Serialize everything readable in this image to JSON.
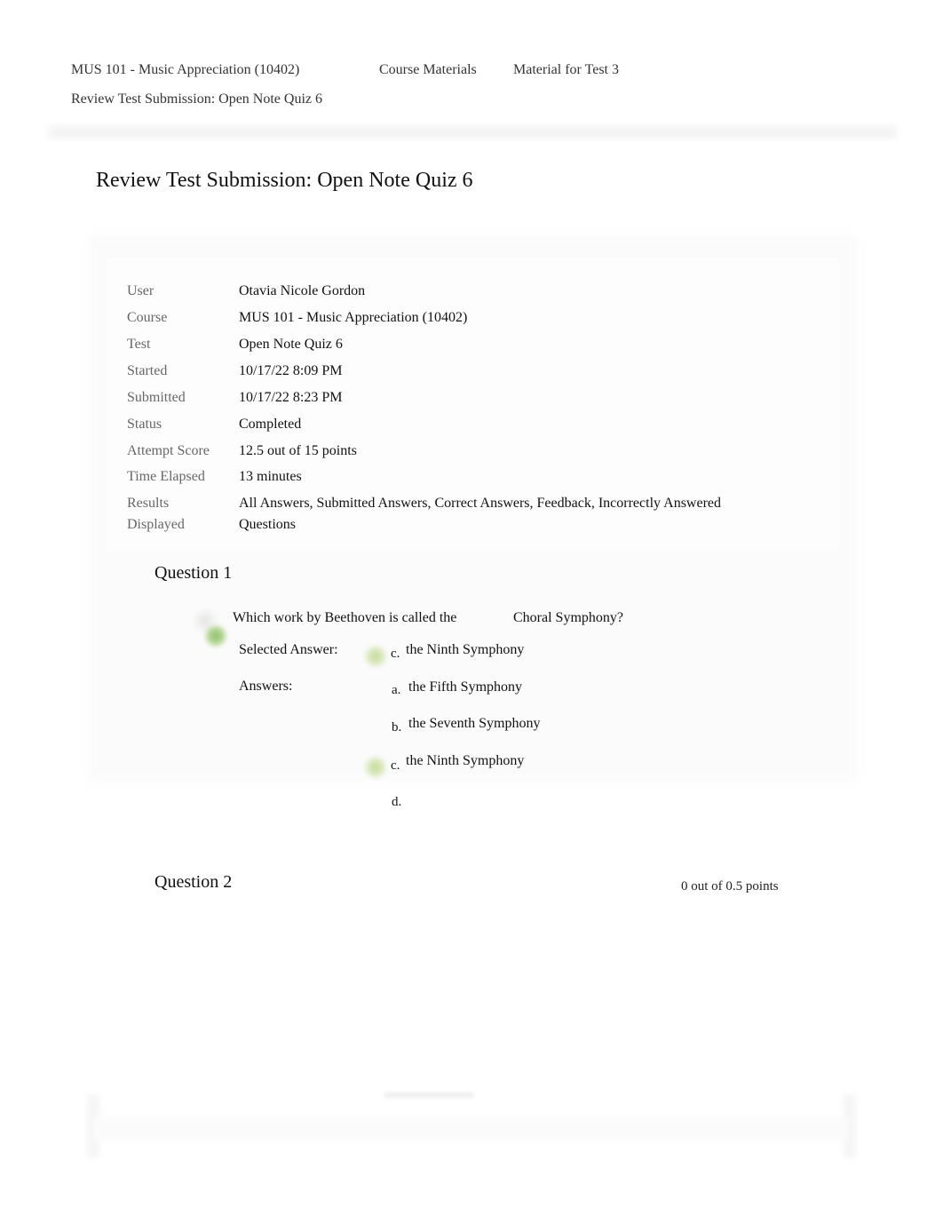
{
  "breadcrumbs": {
    "course": "MUS 101 - Music Appreciation (10402)",
    "course_materials": "Course Materials",
    "material_for_test": "Material for Test 3",
    "current": "Review Test Submission: Open Note Quiz 6"
  },
  "page_title": "Review Test Submission: Open Note Quiz 6",
  "info": [
    {
      "label": "User",
      "value": "Otavia Nicole Gordon"
    },
    {
      "label": "Course",
      "value": "MUS 101 - Music Appreciation (10402)"
    },
    {
      "label": "Test",
      "value": "Open Note Quiz 6"
    },
    {
      "label": "Started",
      "value": "10/17/22 8:09 PM"
    },
    {
      "label": "Submitted",
      "value": "10/17/22 8:23 PM"
    },
    {
      "label": "Status",
      "value": "Completed"
    },
    {
      "label": "Attempt Score",
      "value": "12.5 out of 15 points"
    },
    {
      "label": "Time Elapsed",
      "value": "13 minutes"
    },
    {
      "label_line1": "Results",
      "label_line2": "Displayed",
      "value_line1": "All Answers, Submitted Answers, Correct Answers, Feedback, Incorrectly Answered",
      "value_line2": "Questions"
    }
  ],
  "questions": [
    {
      "title": "Question 1",
      "text_part1": "Which work by Beethoven is called the",
      "text_part2": "Choral  Symphony?",
      "selected_label": "Selected Answer:",
      "selected_letter": "c.",
      "selected_answer": "the Ninth Symphony",
      "answers_label": "Answers:",
      "answers": [
        {
          "letter": "a.",
          "text": "the Fifth Symphony",
          "correct": false
        },
        {
          "letter": "b.",
          "text": "the Seventh Symphony",
          "correct": false
        },
        {
          "letter": "c.",
          "text": "the Ninth Symphony",
          "correct": true
        },
        {
          "letter": "d.",
          "text": "",
          "correct": false
        }
      ],
      "status_icon": "correct-check-icon"
    },
    {
      "title": "Question 2",
      "points": "0 out of 0.5 points"
    }
  ],
  "colors": {
    "correct_green": "#8fc06a",
    "label_grey": "#666666"
  }
}
